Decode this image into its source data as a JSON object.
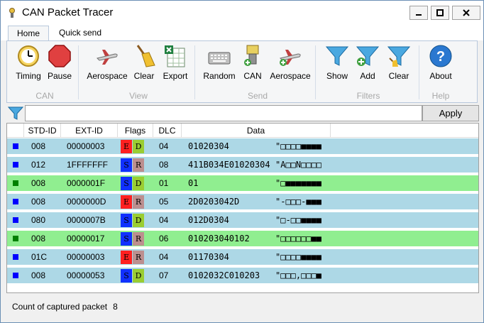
{
  "window": {
    "title": "CAN Packet Tracer"
  },
  "tabs": [
    {
      "label": "Home"
    },
    {
      "label": "Quick send"
    }
  ],
  "ribbon": {
    "buttons": [
      {
        "label": "Timing",
        "icon": "clock-icon"
      },
      {
        "label": "Pause",
        "icon": "stop-icon"
      },
      {
        "label": "Aerospace",
        "icon": "airplane-icon"
      },
      {
        "label": "Clear",
        "icon": "broom-icon"
      },
      {
        "label": "Export",
        "icon": "excel-icon"
      },
      {
        "label": "Random",
        "icon": "keyboard-icon"
      },
      {
        "label": "CAN",
        "icon": "plug-icon"
      },
      {
        "label": "Aerospace",
        "icon": "airplane-add-icon"
      },
      {
        "label": "Show",
        "icon": "funnel-icon"
      },
      {
        "label": "Add",
        "icon": "funnel-add-icon"
      },
      {
        "label": "Clear",
        "icon": "funnel-clear-icon"
      },
      {
        "label": "About",
        "icon": "help-icon"
      }
    ],
    "groups": [
      "CAN",
      "View",
      "Send",
      "Filters",
      "Help"
    ]
  },
  "filter": {
    "value": "",
    "apply_label": "Apply"
  },
  "columns": [
    "STD-ID",
    "EXT-ID",
    "Flags",
    "DLC",
    "Data"
  ],
  "rows": [
    {
      "std": "008",
      "ext": "00000003",
      "f1": "E",
      "f2": "D",
      "dlc": "04",
      "data": "01020304",
      "ascii": "\"□□□□■■■■"
    },
    {
      "std": "012",
      "ext": "1FFFFFFF",
      "f1": "S",
      "f2": "R",
      "dlc": "08",
      "data": "411B034E01020304",
      "ascii": "\"A□□N□□□□"
    },
    {
      "std": "008",
      "ext": "0000001F",
      "f1": "S",
      "f2": "D",
      "dlc": "01",
      "data": "01",
      "ascii": "\"□■■■■■■■"
    },
    {
      "std": "008",
      "ext": "0000000D",
      "f1": "E",
      "f2": "R",
      "dlc": "05",
      "data": "2D0203042D",
      "ascii": "\"-□□□-■■■"
    },
    {
      "std": "080",
      "ext": "0000007B",
      "f1": "S",
      "f2": "D",
      "dlc": "04",
      "data": "012D0304",
      "ascii": "\"□-□□■■■■"
    },
    {
      "std": "008",
      "ext": "00000017",
      "f1": "S",
      "f2": "R",
      "dlc": "06",
      "data": "010203040102",
      "ascii": "\"□□□□□□■■"
    },
    {
      "std": "01C",
      "ext": "00000003",
      "f1": "E",
      "f2": "R",
      "dlc": "04",
      "data": "01170304",
      "ascii": "\"□□□□■■■■"
    },
    {
      "std": "008",
      "ext": "00000053",
      "f1": "S",
      "f2": "D",
      "dlc": "07",
      "data": "0102032C010203",
      "ascii": "\"□□□,□□□■"
    }
  ],
  "status": {
    "label": "Count of captured packet",
    "count": "8"
  },
  "colors": {
    "row_blue": "#add8e6",
    "row_green": "#90ee90",
    "flag_E": "#ff2020",
    "flag_S": "#1030ff",
    "flag_D": "#9acd32",
    "flag_R": "#bc8f8f",
    "sq_blue": "#0000ff",
    "sq_green": "#008000"
  }
}
